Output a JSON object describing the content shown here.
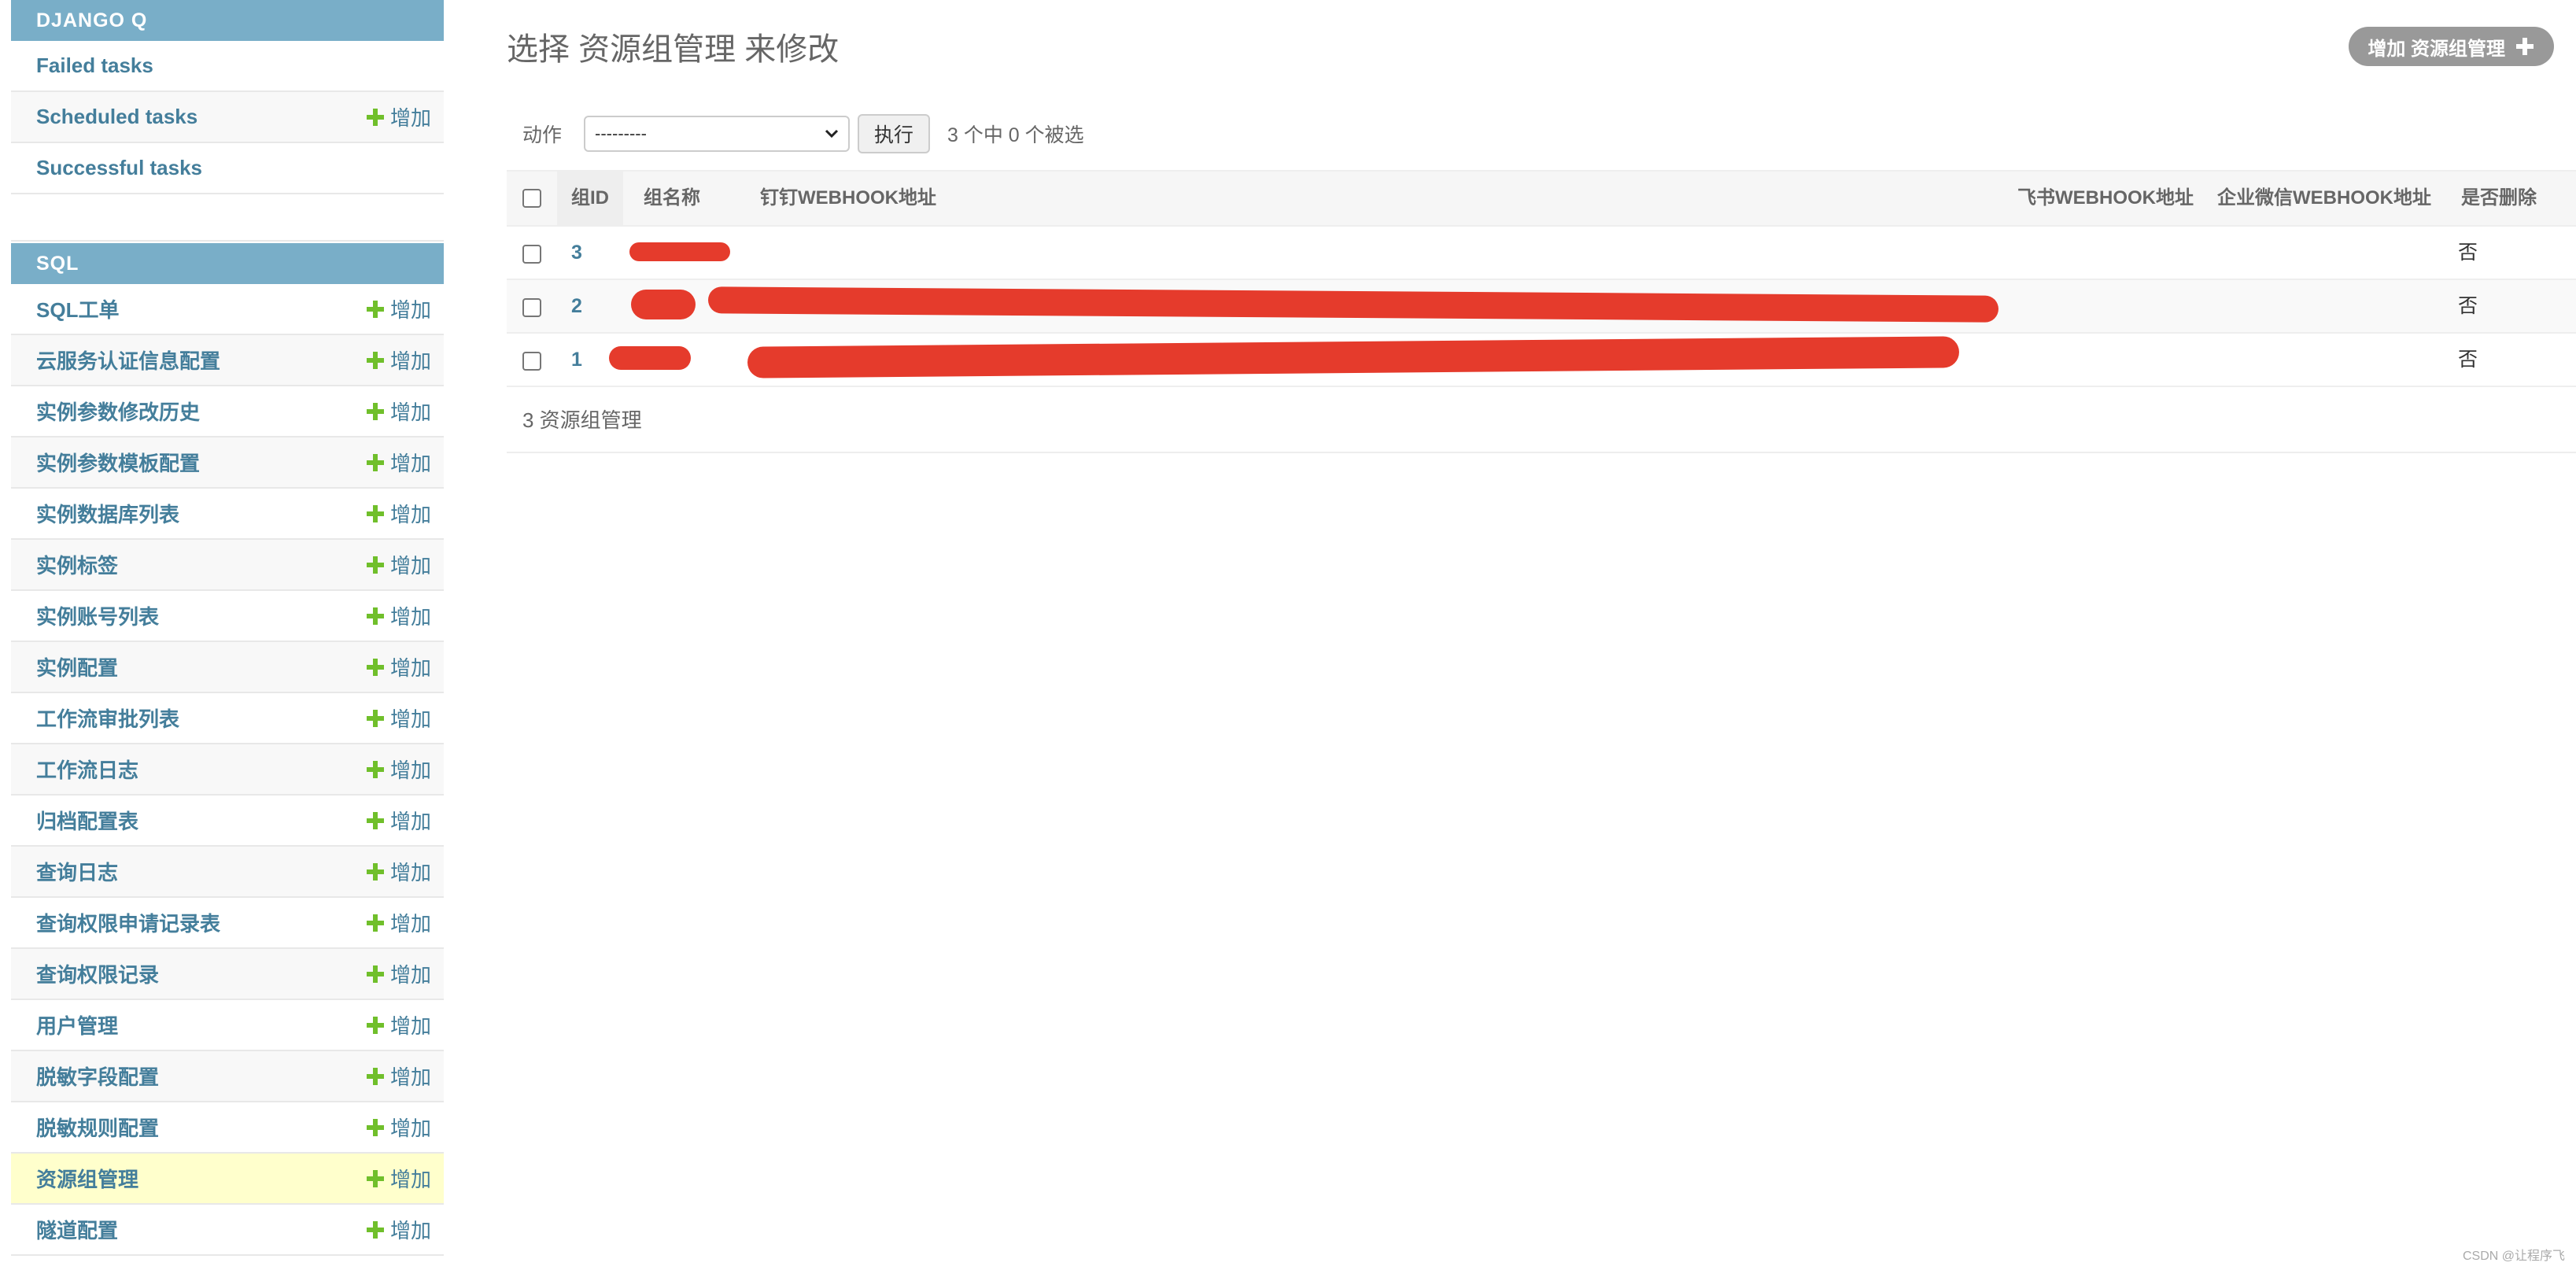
{
  "sidebar": {
    "django_q": {
      "header": "DJANGO Q",
      "items": [
        {
          "label": "Failed tasks",
          "add": ""
        },
        {
          "label": "Scheduled tasks",
          "add": "增加"
        },
        {
          "label": "Successful tasks",
          "add": ""
        }
      ]
    },
    "sql": {
      "header": "SQL",
      "items": [
        {
          "label": "SQL工单",
          "add": "增加"
        },
        {
          "label": "云服务认证信息配置",
          "add": "增加"
        },
        {
          "label": "实例参数修改历史",
          "add": "增加"
        },
        {
          "label": "实例参数模板配置",
          "add": "增加"
        },
        {
          "label": "实例数据库列表",
          "add": "增加"
        },
        {
          "label": "实例标签",
          "add": "增加"
        },
        {
          "label": "实例账号列表",
          "add": "增加"
        },
        {
          "label": "实例配置",
          "add": "增加"
        },
        {
          "label": "工作流审批列表",
          "add": "增加"
        },
        {
          "label": "工作流日志",
          "add": "增加"
        },
        {
          "label": "归档配置表",
          "add": "增加"
        },
        {
          "label": "查询日志",
          "add": "增加"
        },
        {
          "label": "查询权限申请记录表",
          "add": "增加"
        },
        {
          "label": "查询权限记录",
          "add": "增加"
        },
        {
          "label": "用户管理",
          "add": "增加"
        },
        {
          "label": "脱敏字段配置",
          "add": "增加"
        },
        {
          "label": "脱敏规则配置",
          "add": "增加"
        },
        {
          "label": "资源组管理",
          "add": "增加"
        },
        {
          "label": "隧道配置",
          "add": "增加"
        }
      ]
    }
  },
  "main": {
    "title": "选择 资源组管理 来修改",
    "add_button": "增加 资源组管理",
    "actions": {
      "label": "动作",
      "select_value": "---------",
      "go_button": "执行",
      "counter": "3 个中 0 个被选"
    },
    "table": {
      "columns": [
        "组ID",
        "组名称",
        "钉钉WEBHOOK地址",
        "飞书WEBHOOK地址",
        "企业微信WEBHOOK地址",
        "是否删除"
      ],
      "rows": [
        {
          "id": "3",
          "deleted": "否"
        },
        {
          "id": "2",
          "deleted": "否"
        },
        {
          "id": "1",
          "deleted": "否"
        }
      ]
    },
    "footer": "3 资源组管理"
  },
  "watermark": "CSDN @让程序飞",
  "colors": {
    "module_header": "#79aec8",
    "link": "#447e9b",
    "add_plus": "#70bf2b",
    "current_row": "#ffffcc",
    "redaction": "#e53b2c"
  }
}
